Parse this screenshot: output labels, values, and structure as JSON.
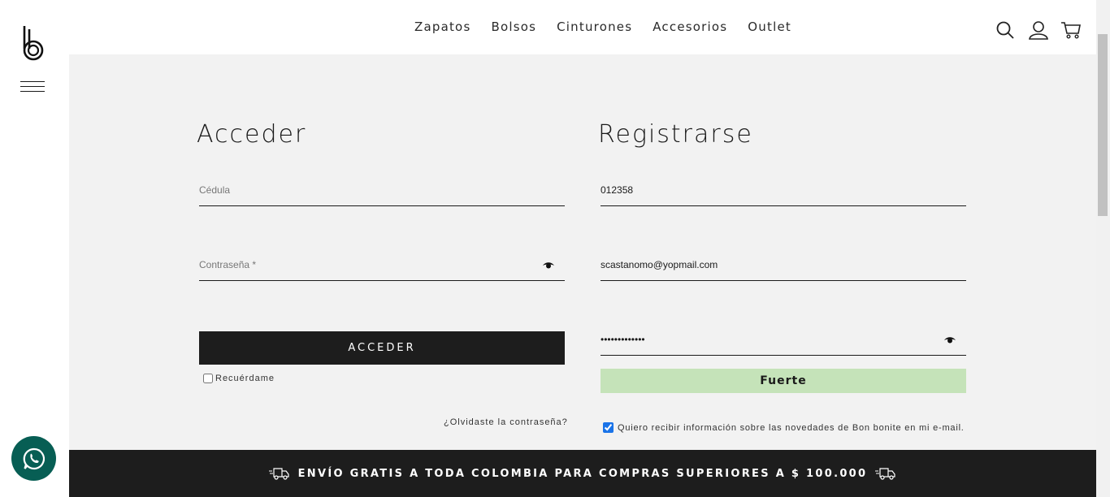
{
  "nav": {
    "items": [
      "Zapatos",
      "Bolsos",
      "Cinturones",
      "Accesorios",
      "Outlet"
    ]
  },
  "login": {
    "title": "Acceder",
    "cedula_placeholder": "Cédula",
    "password_placeholder": "Contraseña *",
    "submit_label": "ACCEDER",
    "remember_label": "Recuérdame",
    "forgot_label": "¿Olvidaste la contraseña?"
  },
  "register": {
    "title": "Registrarse",
    "cedula_value": "012358",
    "email_value": "scastanomo@yopmail.com",
    "password_value": "•••••••••••••",
    "strength_label": "Fuerte",
    "newsletter_label": "Quiero recibir información sobre las novedades de Bon bonite en mi e-mail.",
    "newsletter_checked": true
  },
  "banner": {
    "text": "ENVÍO GRATIS A TODA COLOMBIA PARA COMPRAS SUPERIORES A $ 100.000"
  },
  "icons": [
    "logo-icon",
    "hamburger-icon",
    "search-icon",
    "user-icon",
    "cart-icon",
    "eye-icon",
    "truck-icon",
    "whatsapp-icon"
  ],
  "colors": {
    "background_main": "#f2f2f2",
    "button_dark": "#1d1d1d",
    "strength_bg": "#c5e3b9",
    "whatsapp_bg": "#075e54"
  }
}
